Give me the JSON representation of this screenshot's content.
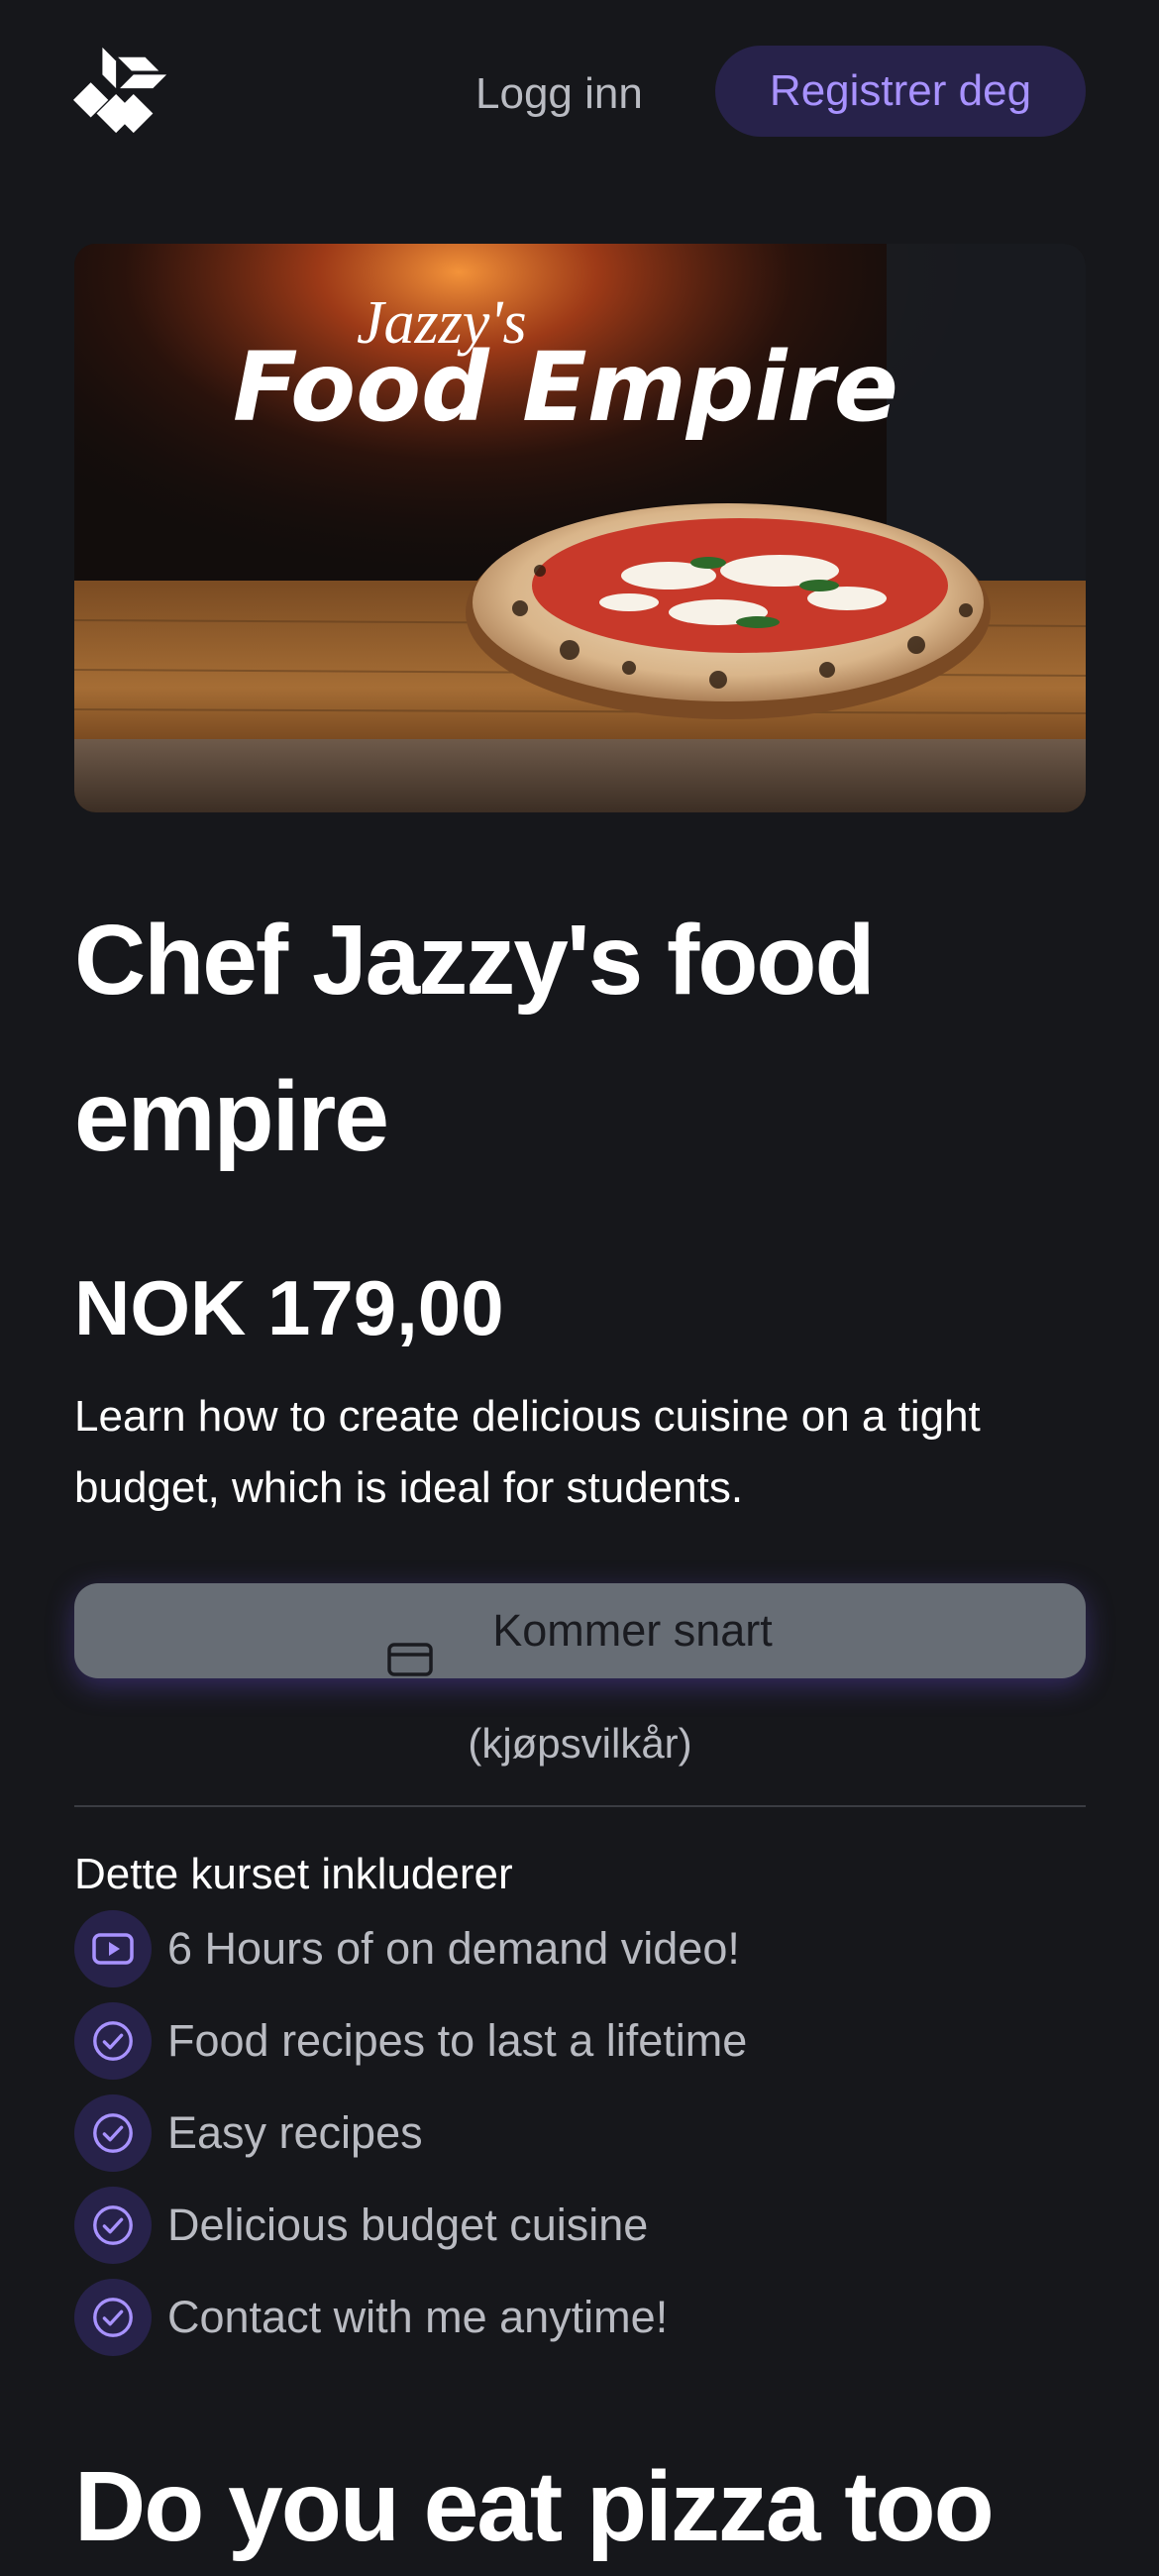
{
  "header": {
    "login_label": "Logg inn",
    "register_label": "Registrer deg"
  },
  "hero": {
    "script_text": "Jazzy's",
    "headline_text": "Food Empire"
  },
  "product": {
    "title": "Chef Jazzy's food empire",
    "price": "NOK 179,00",
    "description": "Learn how to create delicious cuisine on a tight budget, which is ideal for students.",
    "cta_label": "Kommer snart",
    "terms_link": "(kjøpsvilkår)"
  },
  "includes": {
    "heading": "Dette kurset inkluderer",
    "items": [
      {
        "label": "6 Hours of on demand video!",
        "icon": "video-icon"
      },
      {
        "label": "Food recipes to last a lifetime",
        "icon": "check-circle-icon"
      },
      {
        "label": "Easy recipes",
        "icon": "check-circle-icon"
      },
      {
        "label": "Delicious budget cuisine",
        "icon": "check-circle-icon"
      },
      {
        "label": "Contact with me anytime!",
        "icon": "check-circle-icon"
      }
    ]
  },
  "section": {
    "title": "Do you eat pizza too"
  },
  "colors": {
    "background": "#16171b",
    "accent": "#a892ff",
    "accent_bg": "#27224a",
    "button_disabled": "#676d75",
    "muted_text": "#b9bbc2"
  }
}
